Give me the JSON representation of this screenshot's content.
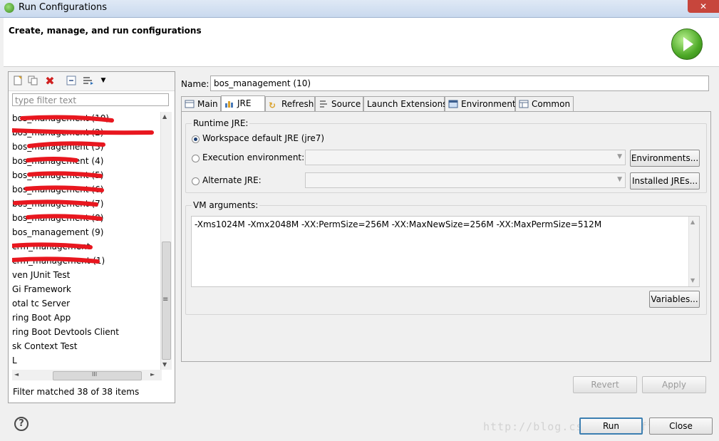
{
  "window": {
    "title": "Run Configurations",
    "close_glyph": "✕"
  },
  "header": {
    "title": "Create, manage, and run configurations"
  },
  "left": {
    "filter_placeholder": "type filter text",
    "items": [
      "bos_management (10)",
      "bos_management (2)",
      "bos_management (3)",
      "bos_management (4)",
      "bos_management (5)",
      "bos_management (6)",
      "bos_management (7)",
      "bos_management (8)",
      "bos_management (9)",
      "crm_management",
      "crm_management (1)",
      "ven JUnit Test",
      "Gi Framework",
      "otal tc Server",
      "ring Boot App",
      "ring Boot Devtools Client",
      "sk Context Test",
      "L"
    ],
    "filter_status": "Filter matched 38 of 38 items",
    "scroll_glyphs": {
      "up": "▲",
      "down": "▼",
      "left": "◄",
      "right": "►",
      "grip": "≡",
      "hgrip": "III"
    }
  },
  "right": {
    "name_label": "Name:",
    "name_value": "bos_management (10)",
    "tabs": [
      "Main",
      "JRE",
      "Refresh",
      "Source",
      "Launch Extensions",
      "Environment",
      "Common"
    ],
    "active_tab": "JRE",
    "runtime_jre_label": "Runtime JRE:",
    "workspace_default_label": "Workspace default JRE (jre7)",
    "execution_env_label": "Execution environment:",
    "alternate_jre_label": "Alternate JRE:",
    "environments_button": "Environments...",
    "installed_jres_button": "Installed JREs...",
    "vm_args_label": "VM arguments:",
    "vm_args_value": "-Xms1024M -Xmx2048M -XX:PermSize=256M -XX:MaxNewSize=256M -XX:MaxPermSize=512M",
    "variables_button": "Variables...",
    "revert_button": "Revert",
    "apply_button": "Apply"
  },
  "footer": {
    "help_glyph": "?",
    "run_button": "Run",
    "close_button": "Close",
    "watermark": "http://blog.csdn.net/fffwaetnet"
  },
  "colors": {
    "redaction": "#e8171f",
    "run_green": "#4ca826",
    "default_button_border": "#3c7fb1"
  }
}
